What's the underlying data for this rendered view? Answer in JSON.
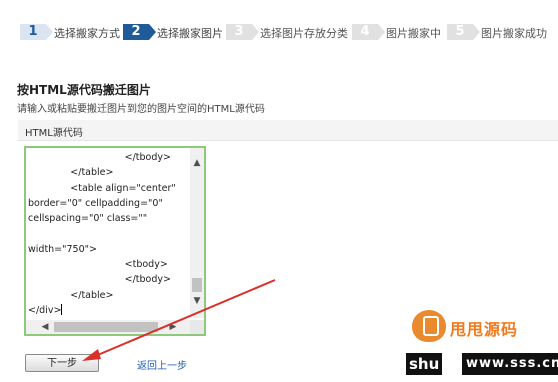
{
  "steps": [
    {
      "num": "1",
      "label": "选择搬家方式",
      "state": "done"
    },
    {
      "num": "2",
      "label": "选择搬家图片",
      "state": "active"
    },
    {
      "num": "3",
      "label": "选择图片存放分类",
      "state": "pending"
    },
    {
      "num": "4",
      "label": "图片搬家中",
      "state": "pending"
    },
    {
      "num": "5",
      "label": "图片搬家成功",
      "state": "pending"
    }
  ],
  "section": {
    "title": "按HTML源代码搬迁图片",
    "description": "请输入或粘贴要搬迁图片到您的图片空间的HTML源代码",
    "field_label": "HTML源代码"
  },
  "code_input": {
    "lines": [
      "                                </tbody>",
      "              </table>",
      "              <table align=\"center\"",
      "border=\"0\" cellpadding=\"0\"",
      "cellspacing=\"0\" class=\"\"",
      "",
      "width=\"750\">",
      "                                <tbody>",
      "                                </tbody>",
      "              </table>",
      "</div>"
    ]
  },
  "actions": {
    "next_label": "下一步",
    "back_label": "返回上一步"
  },
  "watermark": {
    "brand_cn": "甩甩源码",
    "brand_en_1": "shu",
    "brand_en_2": "www.sss.cn"
  },
  "colors": {
    "active_step": "#1f5b99",
    "done_step": "#dbe5f1",
    "pending_step": "#e1e1e1",
    "textarea_border": "#8ec87a",
    "link": "#1f5fb0",
    "annotation_arrow": "#d9302a",
    "watermark_orange": "#f07b1e"
  }
}
